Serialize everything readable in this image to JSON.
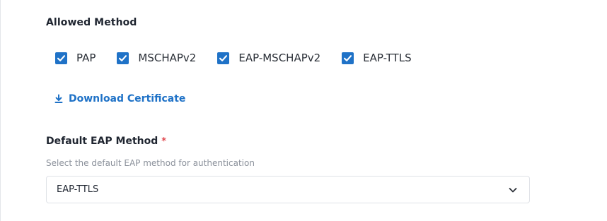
{
  "allowed_method": {
    "title": "Allowed Method",
    "options": [
      {
        "label": "PAP",
        "checked": true
      },
      {
        "label": "MSCHAPv2",
        "checked": true
      },
      {
        "label": "EAP-MSCHAPv2",
        "checked": true
      },
      {
        "label": "EAP-TTLS",
        "checked": true
      }
    ]
  },
  "download": {
    "label": "Download Certificate",
    "icon": "download-icon"
  },
  "default_eap": {
    "label": "Default EAP Method",
    "required_mark": "*",
    "help": "Select the default EAP method for authentication",
    "selected": "EAP-TTLS",
    "icon": "chevron-down-icon"
  },
  "colors": {
    "accent": "#1f72c7",
    "required": "#e0484f",
    "muted_text": "#8b919b",
    "border": "#dfe2e7"
  }
}
